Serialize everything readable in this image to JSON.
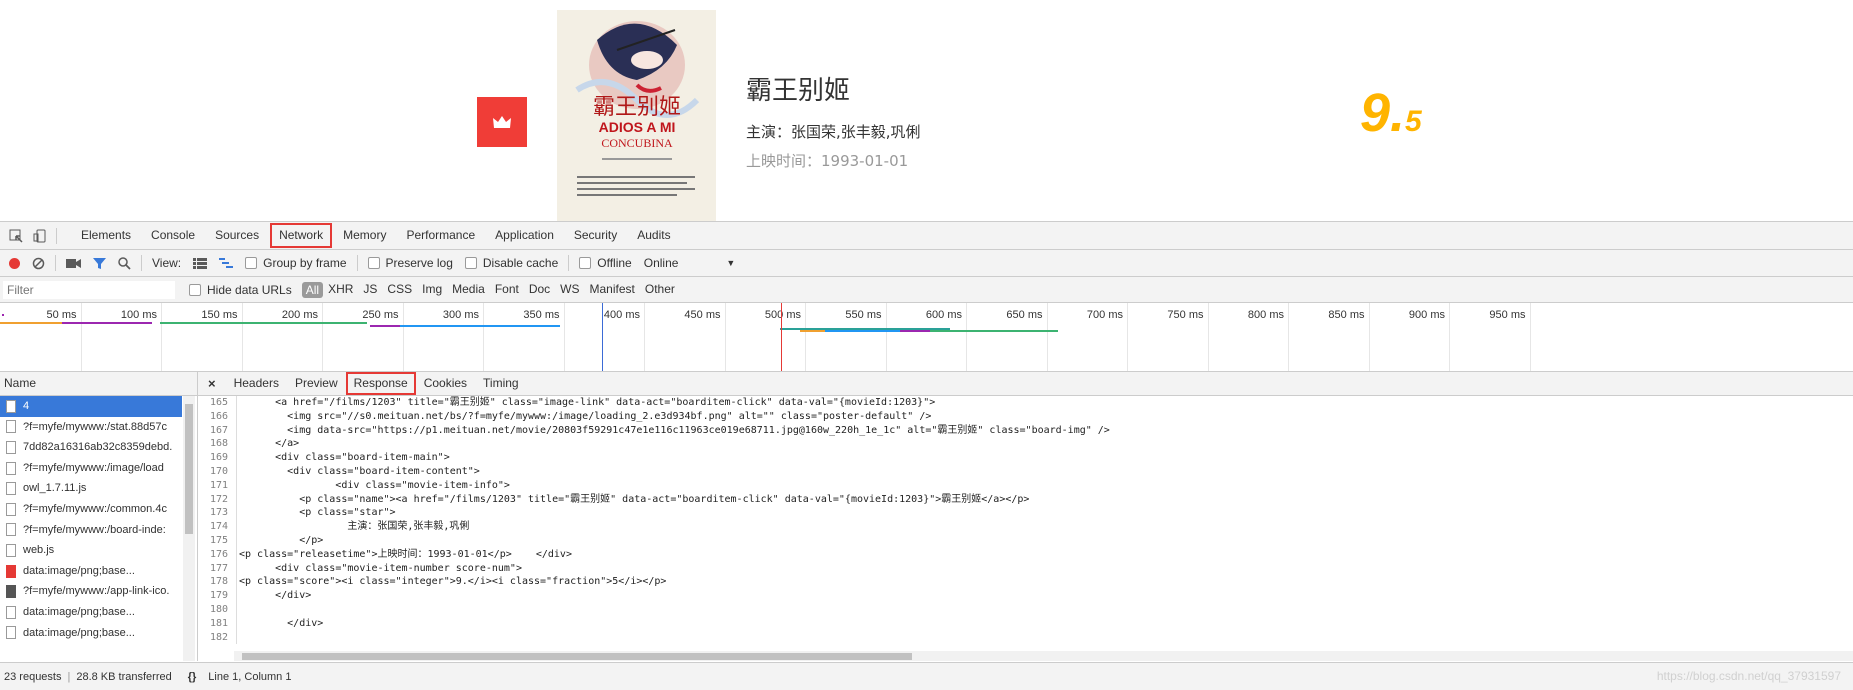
{
  "movie": {
    "title": "霸王别姬",
    "stars": "主演：张国荣,张丰毅,巩俐",
    "release": "上映时间：1993-01-01",
    "score_integer": "9.",
    "score_fraction": "5",
    "poster": {
      "title_cn": "霸王别姬",
      "title_line1": "ADIOS A MI",
      "title_line2": "CONCUBINA"
    }
  },
  "devtools": {
    "tabs": [
      "Elements",
      "Console",
      "Sources",
      "Network",
      "Memory",
      "Performance",
      "Application",
      "Security",
      "Audits"
    ],
    "active_tab": "Network",
    "toolbar": {
      "view_label": "View:",
      "group_by_frame": "Group by frame",
      "preserve_log": "Preserve log",
      "disable_cache": "Disable cache",
      "offline": "Offline",
      "throttle": "Online"
    },
    "filter": {
      "placeholder": "Filter",
      "hide_data_urls": "Hide data URLs",
      "types": [
        "All",
        "XHR",
        "JS",
        "CSS",
        "Img",
        "Media",
        "Font",
        "Doc",
        "WS",
        "Manifest",
        "Other"
      ]
    },
    "timeline_ticks": [
      "50 ms",
      "100 ms",
      "150 ms",
      "200 ms",
      "250 ms",
      "300 ms",
      "350 ms",
      "400 ms",
      "450 ms",
      "500 ms",
      "550 ms",
      "600 ms",
      "650 ms",
      "700 ms",
      "750 ms",
      "800 ms",
      "850 ms",
      "900 ms",
      "950 ms"
    ],
    "name_header": "Name",
    "requests": [
      {
        "name": "4",
        "icon": "file",
        "selected": true
      },
      {
        "name": "?f=myfe/mywww:/stat.88d57c",
        "icon": "file"
      },
      {
        "name": "7dd82a16316ab32c8359debd.",
        "icon": "file"
      },
      {
        "name": "?f=myfe/mywww:/image/load",
        "icon": "file"
      },
      {
        "name": "owl_1.7.11.js",
        "icon": "file"
      },
      {
        "name": "?f=myfe/mywww:/common.4c",
        "icon": "file"
      },
      {
        "name": "?f=myfe/mywww:/board-inde:",
        "icon": "file"
      },
      {
        "name": "web.js",
        "icon": "file"
      },
      {
        "name": "data:image/png;base...",
        "icon": "red"
      },
      {
        "name": "?f=myfe/mywww:/app-link-ico.",
        "icon": "dark"
      },
      {
        "name": "data:image/png;base...",
        "icon": "file"
      },
      {
        "name": "data:image/png;base...",
        "icon": "file"
      }
    ],
    "detail_tabs": [
      "Headers",
      "Preview",
      "Response",
      "Cookies",
      "Timing"
    ],
    "active_detail_tab": "Response",
    "code_lines": [
      {
        "n": "165",
        "text": "      <a href=\"/films/1203\" title=\"霸王别姬\" class=\"image-link\" data-act=\"boarditem-click\" data-val=\"{movieId:1203}\">"
      },
      {
        "n": "166",
        "text": "        <img src=\"//s0.meituan.net/bs/?f=myfe/mywww:/image/loading_2.e3d934bf.png\" alt=\"\" class=\"poster-default\" />"
      },
      {
        "n": "167",
        "text": "        <img data-src=\"https://p1.meituan.net/movie/20803f59291c47e1e116c11963ce019e68711.jpg@160w_220h_1e_1c\" alt=\"霸王别姬\" class=\"board-img\" />"
      },
      {
        "n": "168",
        "text": "      </a>"
      },
      {
        "n": "169",
        "text": "      <div class=\"board-item-main\">"
      },
      {
        "n": "170",
        "text": "        <div class=\"board-item-content\">"
      },
      {
        "n": "171",
        "text": "                <div class=\"movie-item-info\">"
      },
      {
        "n": "172",
        "text": "          <p class=\"name\"><a href=\"/films/1203\" title=\"霸王别姬\" data-act=\"boarditem-click\" data-val=\"{movieId:1203}\">霸王别姬</a></p>"
      },
      {
        "n": "173",
        "text": "          <p class=\"star\">"
      },
      {
        "n": "174",
        "text": "                  主演：张国荣,张丰毅,巩俐"
      },
      {
        "n": "175",
        "text": "          </p>"
      },
      {
        "n": "176",
        "text": "<p class=\"releasetime\">上映时间：1993-01-01</p>    </div>"
      },
      {
        "n": "177",
        "text": "      <div class=\"movie-item-number score-num\">"
      },
      {
        "n": "178",
        "text": "<p class=\"score\"><i class=\"integer\">9.</i><i class=\"fraction\">5</i></p>"
      },
      {
        "n": "179",
        "text": "      </div>"
      },
      {
        "n": "180",
        "text": ""
      },
      {
        "n": "181",
        "text": "        </div>"
      },
      {
        "n": "182",
        "text": "      "
      }
    ],
    "status": {
      "requests": "23 requests",
      "transferred": "28.8 KB transferred",
      "cursor": "Line 1, Column 1",
      "format_icon": "{}",
      "watermark": "https://blog.csdn.net/qq_37931597"
    }
  },
  "colors": {
    "accent_red": "#e53935",
    "score_yellow": "#ffb400",
    "badge_red": "#f03d37",
    "selected_blue": "#3879d9"
  }
}
